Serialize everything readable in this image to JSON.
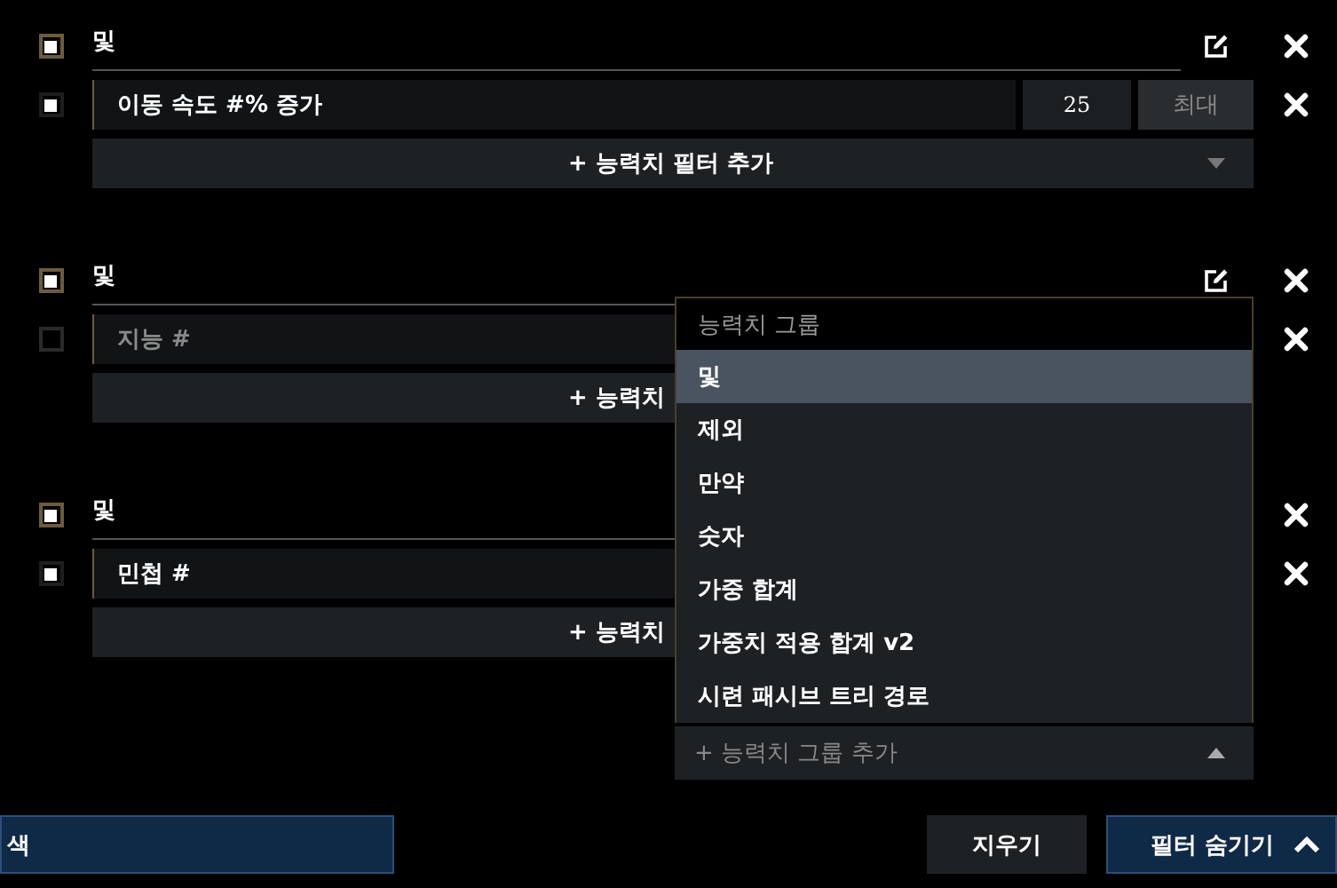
{
  "groups": [
    {
      "label": "및",
      "checked": true,
      "edit_icon": true,
      "filters": [
        {
          "label": "이동 속도 #% 증가",
          "checked": true,
          "min": "25",
          "max_placeholder": "최대"
        }
      ],
      "add_filter": "+ 능력치 필터 추가",
      "chevron": true
    },
    {
      "label": "및",
      "checked": true,
      "edit_icon": true,
      "filters": [
        {
          "label": "지능 #",
          "checked": false
        }
      ],
      "add_filter": "+ 능력치",
      "chevron": false
    },
    {
      "label": "및",
      "checked": true,
      "edit_icon": false,
      "filters": [
        {
          "label": "민첩 #",
          "checked": true
        }
      ],
      "add_filter": "+ 능력치",
      "chevron": false
    }
  ],
  "dropdown": {
    "header": "능력치 그룹",
    "options": [
      {
        "label": "및",
        "selected": true
      },
      {
        "label": "제외",
        "selected": false
      },
      {
        "label": "만약",
        "selected": false
      },
      {
        "label": "숫자",
        "selected": false
      },
      {
        "label": "가중 합계",
        "selected": false
      },
      {
        "label": "가중치 적용 합계 v2",
        "selected": false
      },
      {
        "label": "시련 패시브 트리 경로",
        "selected": false
      }
    ],
    "footer": "+ 능력치 그룹 추가"
  },
  "search_button": "색",
  "clear_button": "지우기",
  "hide_filters_button": "필터 숨기기"
}
